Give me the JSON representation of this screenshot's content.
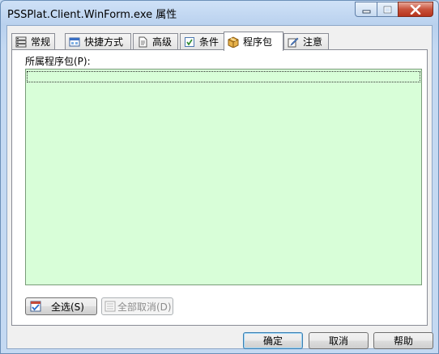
{
  "window": {
    "title": "PSSPlat.Client.WinForm.exe 属性"
  },
  "tabs": [
    {
      "label": "常规",
      "icon": "general-icon"
    },
    {
      "label": "快捷方式",
      "icon": "shortcut-icon"
    },
    {
      "label": "高级",
      "icon": "advanced-icon"
    },
    {
      "label": "条件",
      "icon": "conditions-icon"
    },
    {
      "label": "程序包",
      "icon": "package-icon"
    },
    {
      "label": "注意",
      "icon": "notes-icon"
    }
  ],
  "active_tab": "程序包",
  "panel": {
    "packages_label": "所属程序包(P):",
    "select_all_label": "全选(S)",
    "deselect_all_label": "全部取消(D)"
  },
  "footer": {
    "ok_label": "确定",
    "cancel_label": "取消",
    "help_label": "帮助"
  },
  "colors": {
    "list_background": "#d8fed8",
    "tab_border": "#898c95",
    "close_button": "#c8523b"
  }
}
